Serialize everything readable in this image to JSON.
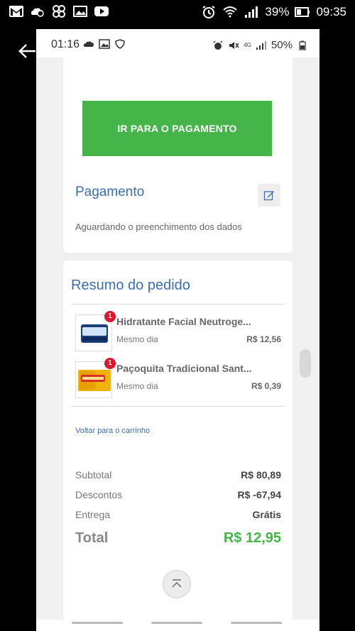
{
  "outer_status": {
    "battery": "39%",
    "time": "09:35"
  },
  "inner_status": {
    "time": "01:16",
    "network": "4G",
    "battery": "50%"
  },
  "payment_button": {
    "label": "IR PARA O PAGAMENTO",
    "color": "#46b549"
  },
  "payment_section": {
    "title": "Pagamento",
    "status": "Aguardando o preenchimento dos dados"
  },
  "order_summary": {
    "title": "Resumo do pedido",
    "items": [
      {
        "name": "Hidratante Facial Neutroge...",
        "delivery": "Mesmo dia",
        "price": "R$ 12,56",
        "quantity": "1"
      },
      {
        "name": "Paçoquita Tradicional Sant...",
        "delivery": "Mesmo dia",
        "price": "R$ 0,39",
        "quantity": "1"
      }
    ],
    "back_to_cart": "Voltar para o carrinho",
    "subtotal_label": "Subtotal",
    "subtotal_value": "R$ 80,89",
    "discounts_label": "Descontos",
    "discounts_value": "R$ -67,94",
    "delivery_label": "Entrega",
    "delivery_value": "Grátis",
    "total_label": "Total",
    "total_value": "R$ 12,95"
  },
  "colors": {
    "accent_blue": "#3b6fb1",
    "badge_red": "#d9182d"
  }
}
